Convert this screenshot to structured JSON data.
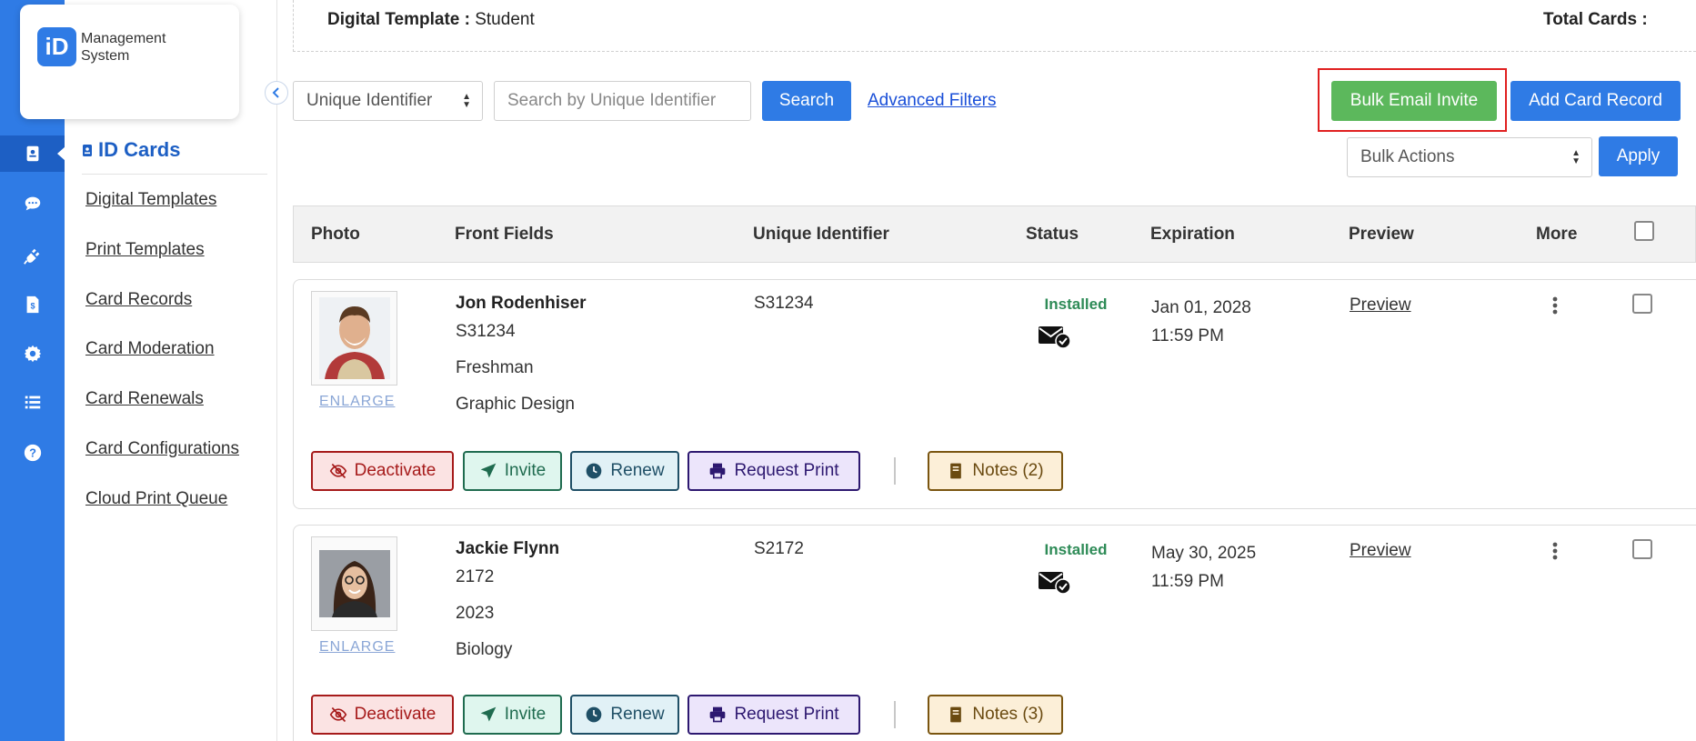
{
  "app": {
    "logo_mark": "iD",
    "logo_text": [
      "Management",
      "System"
    ]
  },
  "rail": {
    "icons": [
      "id-card-icon",
      "chat-icon",
      "plug-icon",
      "invoice-icon",
      "gear-icon",
      "list-icon",
      "help-icon"
    ],
    "accent": "#2f7be5"
  },
  "sidebar": {
    "section_title": "ID Cards",
    "items": [
      {
        "label": "Digital Templates"
      },
      {
        "label": "Print Templates"
      },
      {
        "label": "Card Records"
      },
      {
        "label": "Card Moderation"
      },
      {
        "label": "Card Renewals"
      },
      {
        "label": "Card Configurations"
      },
      {
        "label": "Cloud Print Queue"
      }
    ]
  },
  "header": {
    "digital_template_label": "Digital Template :",
    "digital_template_value": "Student",
    "total_cards_label": "Total Cards :"
  },
  "filters": {
    "field_select": "Unique Identifier",
    "search_placeholder": "Search by Unique Identifier",
    "search_button": "Search",
    "advanced_filters": "Advanced Filters",
    "bulk_email_invite": "Bulk Email Invite",
    "add_card_record": "Add Card Record",
    "bulk_actions": "Bulk Actions",
    "apply": "Apply"
  },
  "table": {
    "columns": [
      "Photo",
      "Front Fields",
      "Unique Identifier",
      "Status",
      "Expiration",
      "Preview",
      "More"
    ]
  },
  "records": [
    {
      "name": "Jon Rodenhiser",
      "fields": [
        "S31234",
        "Freshman",
        "Graphic Design"
      ],
      "unique_id": "S31234",
      "status": "Installed",
      "expiration_date": "Jan 01, 2028",
      "expiration_time": "11:59 PM",
      "preview": "Preview",
      "enlarge": "ENLARGE",
      "actions": {
        "deactivate": "Deactivate",
        "invite": "Invite",
        "renew": "Renew",
        "request_print": "Request Print",
        "notes": "Notes (2)"
      }
    },
    {
      "name": "Jackie Flynn",
      "fields": [
        "2172",
        "2023",
        "Biology"
      ],
      "unique_id": "S2172",
      "status": "Installed",
      "expiration_date": "May 30, 2025",
      "expiration_time": "11:59 PM",
      "preview": "Preview",
      "enlarge": "ENLARGE",
      "actions": {
        "deactivate": "Deactivate",
        "invite": "Invite",
        "renew": "Renew",
        "request_print": "Request Print",
        "notes": "Notes (3)"
      }
    }
  ]
}
